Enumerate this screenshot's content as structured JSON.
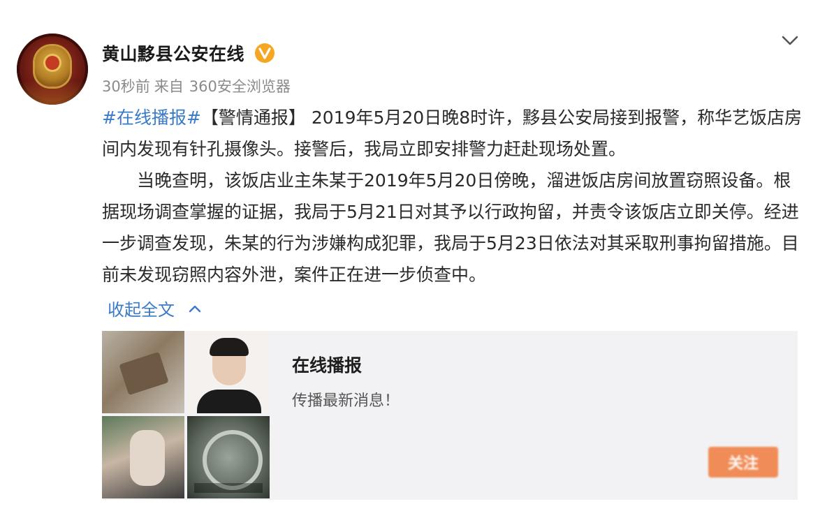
{
  "account": {
    "name": "黄山黟县公安在线",
    "verified_icon": "verified-v-icon",
    "avatar_icon": "police-badge-icon"
  },
  "meta": {
    "time": "30秒前",
    "source_prefix": "来自",
    "source": "360安全浏览器"
  },
  "post": {
    "topic": "#在线播报#",
    "p1_rest": "【警情通报】 2019年5月20日晚8时许，黟县公安局接到报警，称华艺饭店房间内发现有针孔摄像头。接警后，我局立即安排警力赶赴现场处置。",
    "p2": "当晚查明，该饭店业主朱某于2019年5月20日傍晚，溜进饭店房间放置窃照设备。根据现场调查掌握的证据，我局于5月21日对其予以行政拘留，并责令该饭店立即关停。经进一步调查发现，朱某的行为涉嫌构成犯罪，我局于5月23日依法对其采取刑事拘留措施。目前未发现窃照内容外泄，案件正在进一步侦查中。"
  },
  "collapse": {
    "label": "收起全文",
    "icon": "chevron-up-icon"
  },
  "card": {
    "title": "在线播报",
    "description": "传播最新消息！",
    "button_label": "关注"
  },
  "colors": {
    "link": "#3a7bc8",
    "verified": "#f5a623",
    "follow_button": "#f07b3c"
  }
}
